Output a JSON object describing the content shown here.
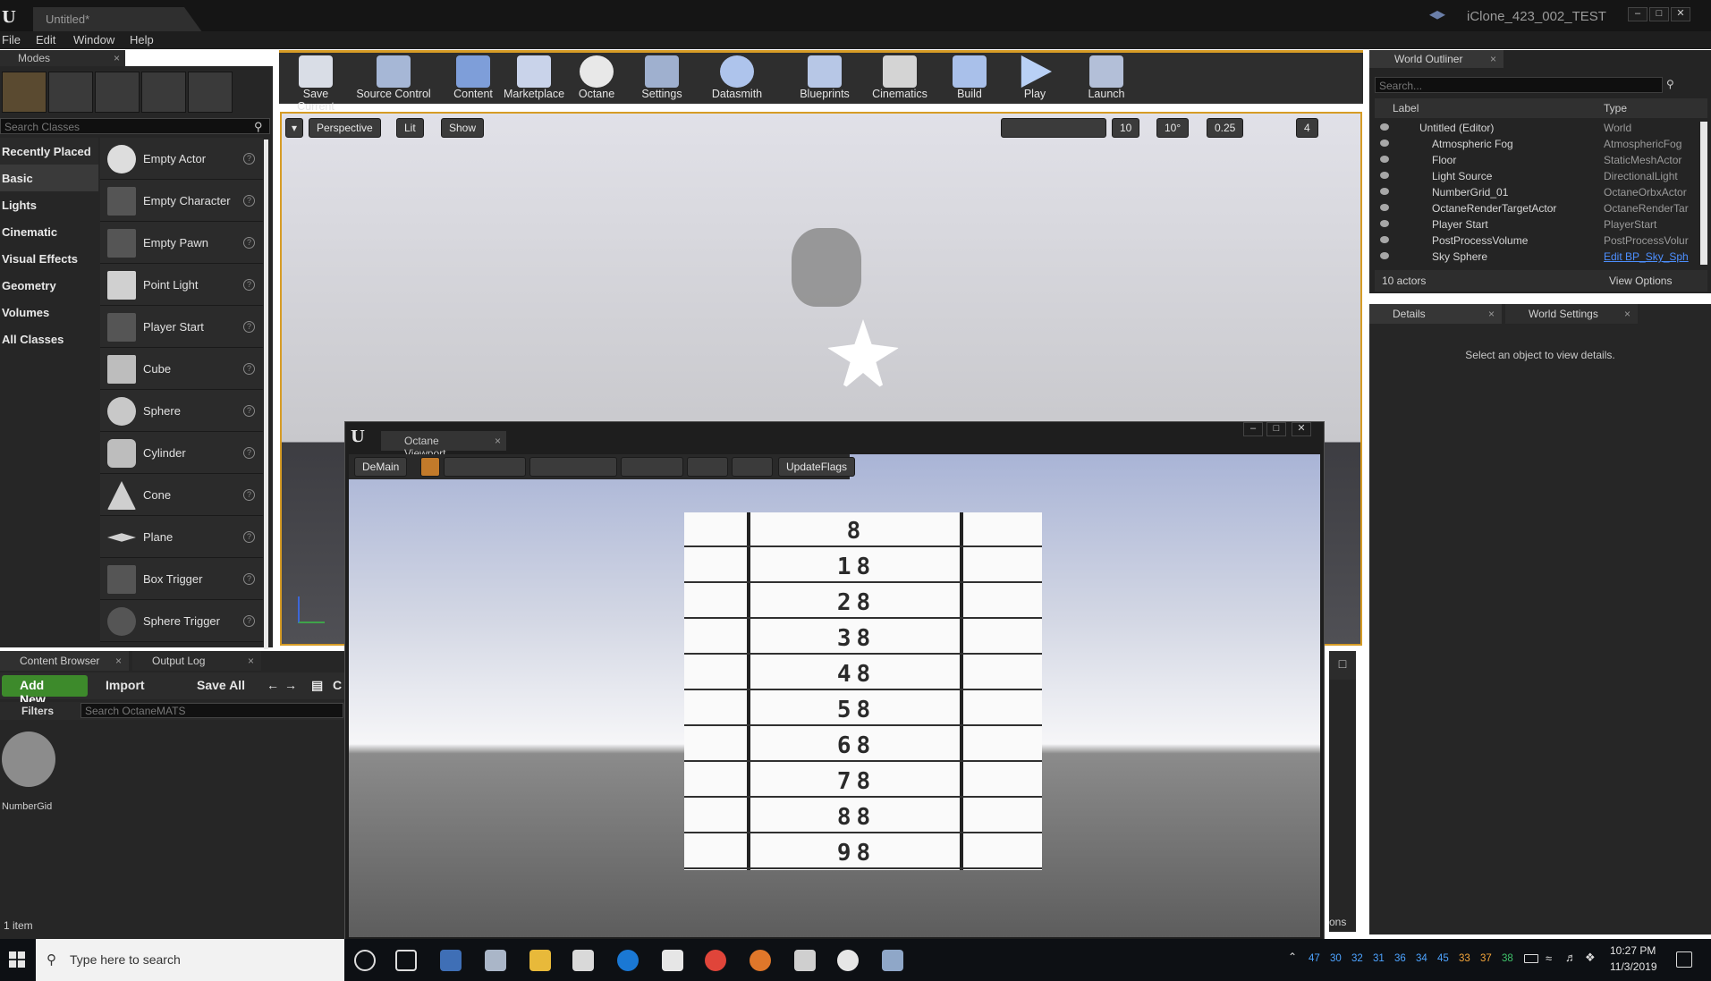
{
  "window": {
    "title": "Untitled*",
    "project": "iClone_423_002_TEST",
    "top_menu_cut": [
      "File",
      "Edit",
      "Window",
      "Help"
    ]
  },
  "menubar": [
    "File",
    "Edit",
    "Window",
    "Help"
  ],
  "modes": {
    "tab": "Modes",
    "search_placeholder": "Search Classes",
    "categories": [
      "Recently Placed",
      "Basic",
      "Lights",
      "Cinematic",
      "Visual Effects",
      "Geometry",
      "Volumes",
      "All Classes"
    ],
    "classes": [
      "Empty Actor",
      "Empty Character",
      "Empty Pawn",
      "Point Light",
      "Player Start",
      "Cube",
      "Sphere",
      "Cylinder",
      "Cone",
      "Plane",
      "Box Trigger",
      "Sphere Trigger"
    ]
  },
  "toolbar": [
    "Save Current",
    "Source Control",
    "Content",
    "Marketplace",
    "Octane",
    "Settings",
    "Datasmith",
    "Blueprints",
    "Cinematics",
    "Build",
    "Play",
    "Launch"
  ],
  "viewport": {
    "buttons": [
      "Perspective",
      "Lit",
      "Show"
    ],
    "grid_snap": "10",
    "rot_snap": "10°",
    "scale_snap": "0.25",
    "cam_speed": "4"
  },
  "octane": {
    "tab": "Octane Viewport",
    "demain": "DeMain",
    "update_flags": "UpdateFlags",
    "grid_numbers": [
      "8",
      "18",
      "28",
      "38",
      "48",
      "58",
      "68",
      "78",
      "88",
      "98"
    ]
  },
  "outliner": {
    "tab": "World Outliner",
    "search_placeholder": "Search...",
    "col_label": "Label",
    "col_type": "Type",
    "rows": [
      {
        "label": "Untitled (Editor)",
        "type": "World"
      },
      {
        "label": "Atmospheric Fog",
        "type": "AtmosphericFog"
      },
      {
        "label": "Floor",
        "type": "StaticMeshActor"
      },
      {
        "label": "Light Source",
        "type": "DirectionalLight"
      },
      {
        "label": "NumberGrid_01",
        "type": "OctaneOrbxActor"
      },
      {
        "label": "OctaneRenderTargetActor",
        "type": "OctaneRenderTar"
      },
      {
        "label": "Player Start",
        "type": "PlayerStart"
      },
      {
        "label": "PostProcessVolume",
        "type": "PostProcessVolur"
      },
      {
        "label": "Sky Sphere",
        "type": "Edit BP_Sky_Sph"
      }
    ],
    "actor_count": "10 actors",
    "view_options": "View Options"
  },
  "details": {
    "tab": "Details",
    "world_settings_tab": "World Settings",
    "empty_msg": "Select an object to view details."
  },
  "content_browser": {
    "tab": "Content Browser",
    "output_log_tab": "Output Log",
    "add_new": "Add New",
    "import": "Import",
    "save_all": "Save All",
    "path_letter": "C",
    "filters": "Filters",
    "search_placeholder": "Search OctaneMATS",
    "asset_name": "NumberGid",
    "item_count": "1 item",
    "cut_text": "ons"
  },
  "taskbar": {
    "search_placeholder": "Type here to search",
    "tray_numbers": [
      "47",
      "30",
      "32",
      "31",
      "36",
      "34",
      "45",
      "33",
      "37",
      "38"
    ],
    "time": "10:27 PM",
    "date": "11/3/2019"
  }
}
